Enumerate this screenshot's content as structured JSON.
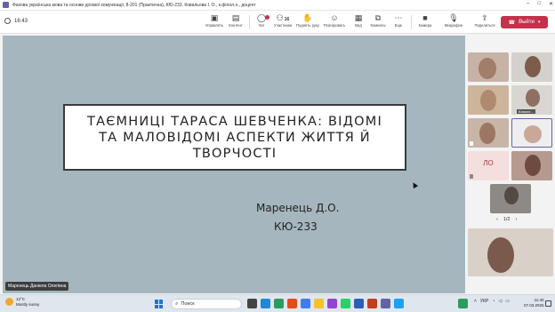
{
  "window": {
    "title": "Фахова українська мова та основи ділової комунікації, 8-201 (Практична), КЮ-233, Ковальова І. О., к.філол.н., доцент",
    "controls": [
      "–",
      "□",
      "✕"
    ]
  },
  "toolbar": {
    "timer": "16:43",
    "items": [
      {
        "label": "Управлять",
        "icon": "share-screen-icon"
      },
      {
        "label": "Контент",
        "icon": "content-icon"
      },
      {
        "label": "Чат",
        "icon": "chat-icon"
      },
      {
        "label": "Участники",
        "icon": "people-icon",
        "count": "16"
      },
      {
        "label": "Поднять руку",
        "icon": "raise-hand-icon"
      },
      {
        "label": "Реагировать",
        "icon": "react-icon"
      },
      {
        "label": "Вид",
        "icon": "view-icon"
      },
      {
        "label": "Комнаты",
        "icon": "rooms-icon"
      },
      {
        "label": "Еще",
        "icon": "more-icon"
      },
      {
        "label": "Камера",
        "icon": "camera-icon"
      },
      {
        "label": "Микрофон",
        "icon": "microphone-icon"
      },
      {
        "label": "Поделиться",
        "icon": "share-icon"
      }
    ],
    "leave_label": "Выйти",
    "accent": "#c4314b"
  },
  "slide": {
    "title": "ТАЄМНИЦІ ТАРАСА ШЕВЧЕНКА: ВІДОМІ ТА МАЛОВІДОМІ АСПЕКТИ ЖИТТЯ Й ТВОРЧОСТІ",
    "author": "Маренець Д.О.",
    "group": "КЮ-233",
    "background": "#a6b6bf"
  },
  "presenter": {
    "name": "Маренець Даніела Олегівна"
  },
  "gallery": {
    "tiles": [
      {
        "kind": "video"
      },
      {
        "kind": "video"
      },
      {
        "kind": "video"
      },
      {
        "kind": "video",
        "name": "Ковале..."
      },
      {
        "kind": "video"
      },
      {
        "kind": "avatar",
        "active": true
      },
      {
        "kind": "initials",
        "initials": "ЛО"
      },
      {
        "kind": "video"
      },
      {
        "kind": "video"
      }
    ],
    "pager": "1/2"
  },
  "taskbar": {
    "weather_temp": "12°C",
    "weather_desc": "Mostly sunny",
    "search_placeholder": "Поиск",
    "lang": "УКР",
    "time": "11:40",
    "date": "07.03.2025"
  }
}
